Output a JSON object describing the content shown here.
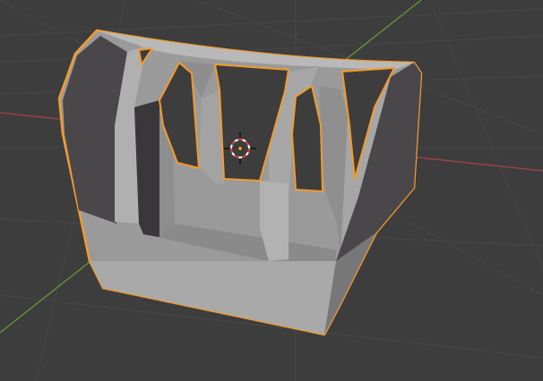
{
  "viewport": {
    "mode": "3d-viewport",
    "shading": "solid",
    "selected_object_state": "selected"
  },
  "colors": {
    "background": "#3d3d3d",
    "grid_line": "#474747",
    "axis_x": "#a8424c",
    "axis_y": "#6b9a37",
    "selection_outline": "#f29a2e",
    "mesh_light": "#a6a6a6",
    "mesh_mid": "#8f8f8f",
    "mesh_dark": "#4a474b",
    "mesh_shadow": "#2f2d31",
    "cursor_red": "#e23b3b",
    "cursor_white": "#ffffff"
  },
  "icons": {
    "cursor": "3d-cursor-icon",
    "origin": "object-origin-icon"
  }
}
